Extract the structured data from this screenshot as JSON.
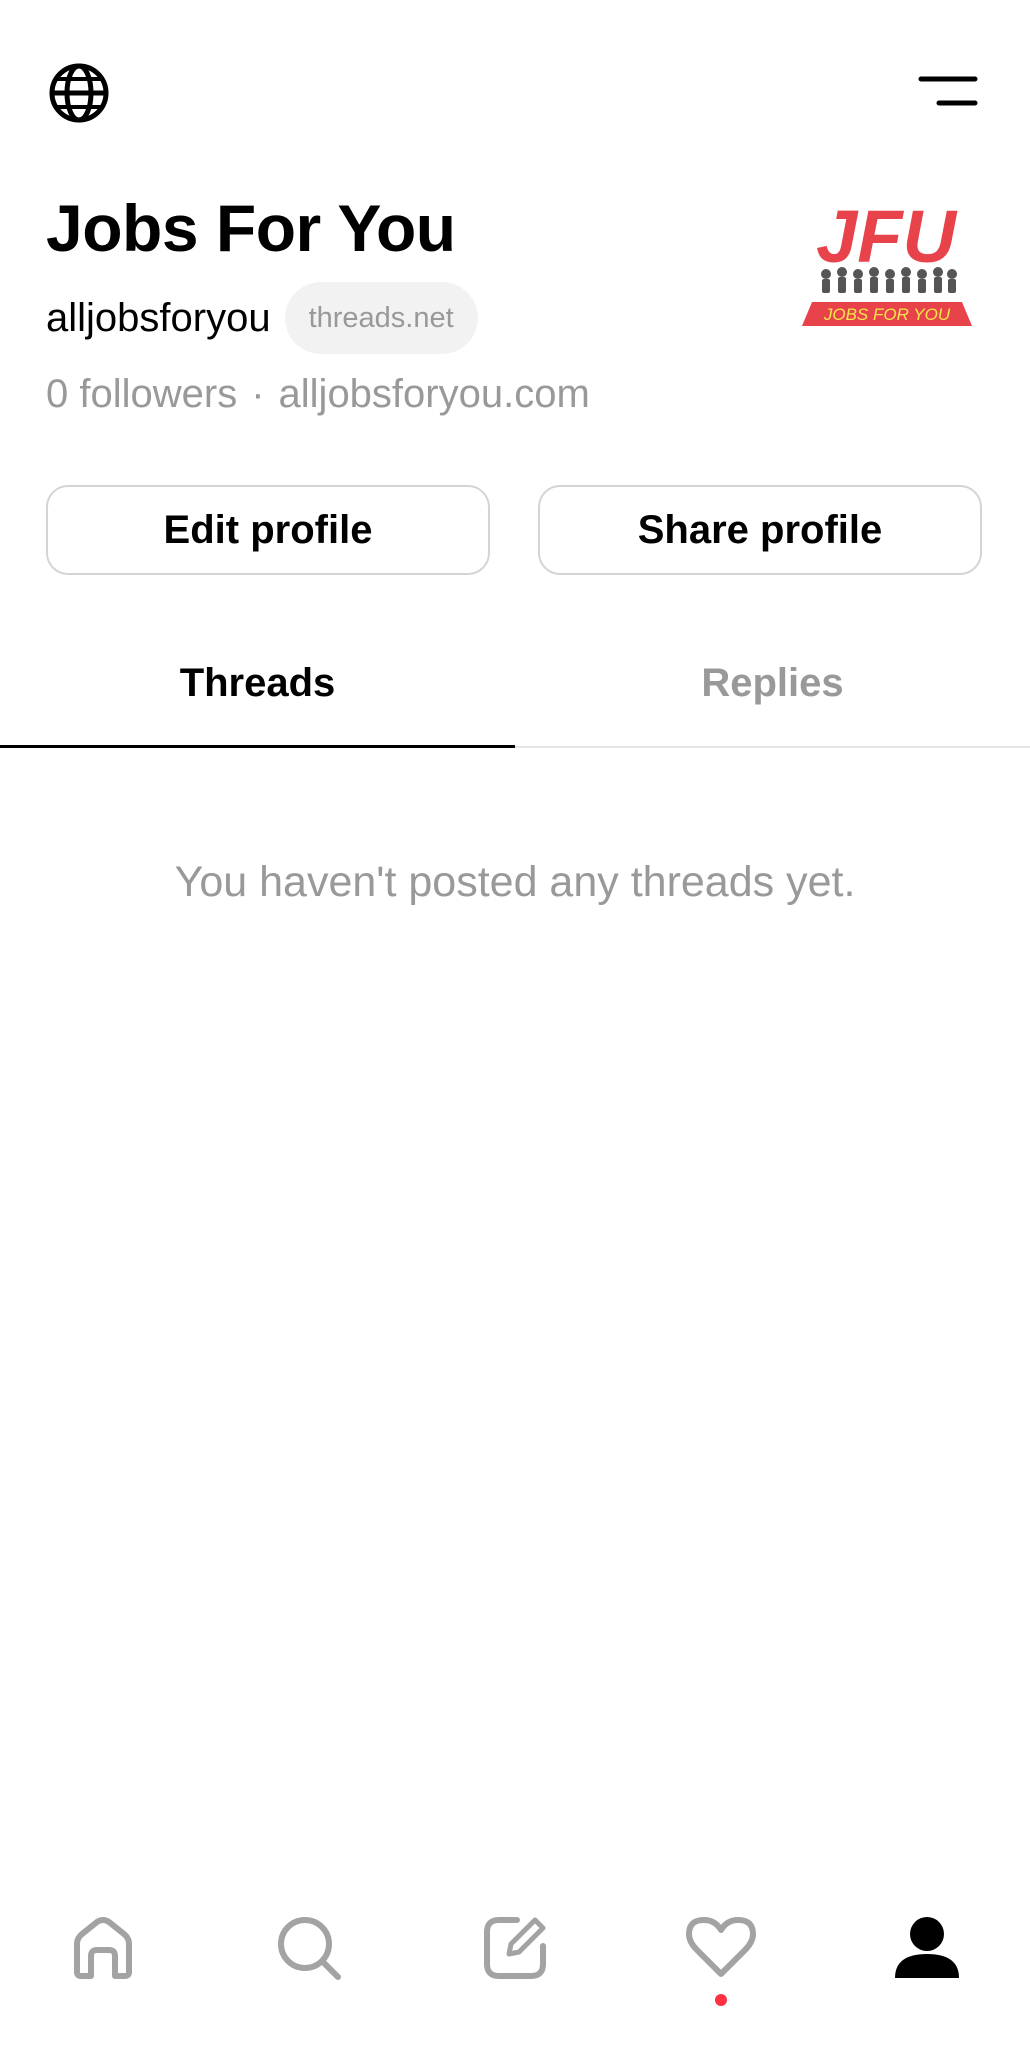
{
  "profile": {
    "name": "Jobs For You",
    "handle": "alljobsforyou",
    "domain_pill": "threads.net",
    "followers": "0 followers",
    "separator": "·",
    "website": "alljobsforyou.com",
    "avatar_logo_text": "JFU",
    "avatar_banner_text": "JOBS FOR YOU"
  },
  "actions": {
    "edit_label": "Edit profile",
    "share_label": "Share profile"
  },
  "tabs": [
    {
      "label": "Threads",
      "active": true
    },
    {
      "label": "Replies",
      "active": false
    }
  ],
  "empty_state": {
    "message": "You haven't posted any threads yet."
  },
  "top_bar": {
    "left_icon": "globe-icon",
    "right_icon": "menu-icon"
  },
  "bottom_nav": [
    {
      "icon": "home-icon",
      "active": false
    },
    {
      "icon": "search-icon",
      "active": false
    },
    {
      "icon": "compose-icon",
      "active": false
    },
    {
      "icon": "heart-icon",
      "active": false,
      "notification_dot": true
    },
    {
      "icon": "profile-icon",
      "active": true
    }
  ],
  "colors": {
    "primary_text": "#000000",
    "secondary_text": "#999999",
    "border": "#d4d4d4",
    "pill_bg": "#f2f2f2",
    "notification": "#ff3040",
    "logo_red": "#e8434b"
  }
}
